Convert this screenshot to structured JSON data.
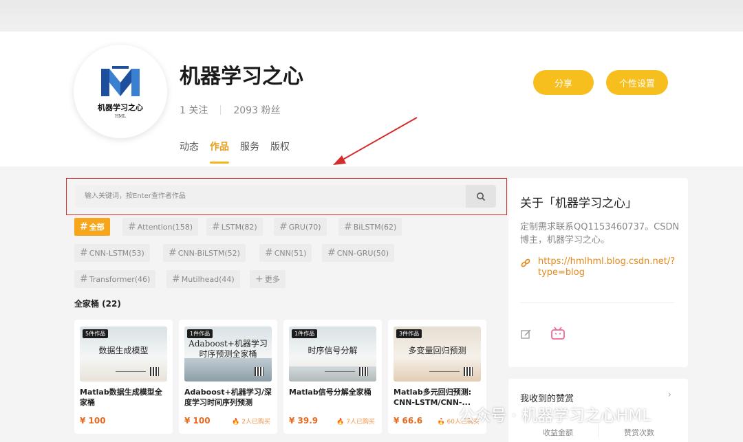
{
  "profile": {
    "name": "机器学习之心",
    "logo_text": "机器学习之心",
    "logo_sub": "HML",
    "following": "1 关注",
    "fans": "2093 粉丝"
  },
  "tabs": [
    {
      "label": "动态",
      "active": false
    },
    {
      "label": "作品",
      "active": true
    },
    {
      "label": "服务",
      "active": false
    },
    {
      "label": "版权",
      "active": false
    }
  ],
  "buttons": {
    "share": "分享",
    "settings": "个性设置"
  },
  "search": {
    "placeholder": "输入关键词，按Enter查作者作品"
  },
  "tags": [
    {
      "label": "全部",
      "active": true
    },
    {
      "label": "Attention(158)"
    },
    {
      "label": "LSTM(82)"
    },
    {
      "label": "GRU(70)"
    },
    {
      "label": "BiLSTM(62)"
    },
    {
      "label": "CNN-LSTM(53)"
    },
    {
      "label": "CNN-BiLSTM(52)"
    },
    {
      "label": "CNN(51)"
    },
    {
      "label": "CNN-GRU(50)"
    },
    {
      "label": "Transformer(46)"
    },
    {
      "label": "Mutilhead(44)"
    },
    {
      "label": "更多"
    }
  ],
  "section": {
    "title": "全家桶 (22)"
  },
  "cards": [
    {
      "badge": "5件作品",
      "thumb_title": "数据生成模型",
      "name": "Matlab数据生成模型全家桶",
      "price": "¥ 100",
      "bought": ""
    },
    {
      "badge": "1件作品",
      "thumb_title": "Adaboost+机器学习",
      "thumb_title2": "时序预测全家桶",
      "name": "Adaboost+机器学习/深度学习时间序列预测",
      "price": "¥ 100",
      "bought": "2人已购买"
    },
    {
      "badge": "1件作品",
      "thumb_title": "时序信号分解",
      "name": "Matlab信号分解全家桶",
      "price": "¥ 39.9",
      "bought": "7人已购买"
    },
    {
      "badge": "3件作品",
      "thumb_title": "多变量回归预测",
      "name": "Matlab多元回归预测: CNN-LSTM/CNN-...",
      "price": "¥ 66.6",
      "bought": "60人已购买"
    }
  ],
  "sidebar": {
    "about": "关于「机器学习之心」",
    "desc": "定制需求联系QQ1153460737。CSDN博主，机器学习之心。",
    "link": "https://hmlhml.blog.csdn.net/?type=blog"
  },
  "rewards": {
    "title": "我收到的赞赏",
    "col1": "收益金额",
    "col2": "赞赏次数"
  },
  "watermark": {
    "text": "公众号 · 机器学习之心HML"
  },
  "colors": {
    "accent": "#f7bf1e",
    "price": "#e76a1d",
    "highlight_frame": "#d42b2b"
  }
}
